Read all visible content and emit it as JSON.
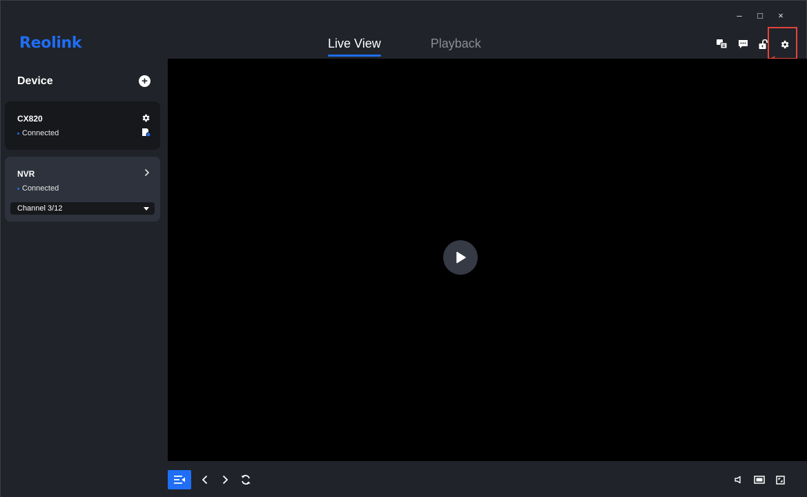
{
  "window": {
    "minimize": "–",
    "maximize": "□",
    "close": "×"
  },
  "app": {
    "logo": "Reolink"
  },
  "tabs": [
    {
      "label": "Live View",
      "active": true
    },
    {
      "label": "Playback",
      "active": false
    }
  ],
  "header_icons": [
    "language-icon",
    "message-icon",
    "unlock-icon",
    "gear-icon"
  ],
  "sidebar": {
    "title": "Device",
    "devices": [
      {
        "name": "CX820",
        "status": "Connected"
      },
      {
        "name": "NVR",
        "status": "Connected",
        "channel": "Channel 3/12"
      }
    ]
  },
  "colors": {
    "accent": "#1f6ef5",
    "highlight": "#e5453a",
    "background": "#202329"
  }
}
